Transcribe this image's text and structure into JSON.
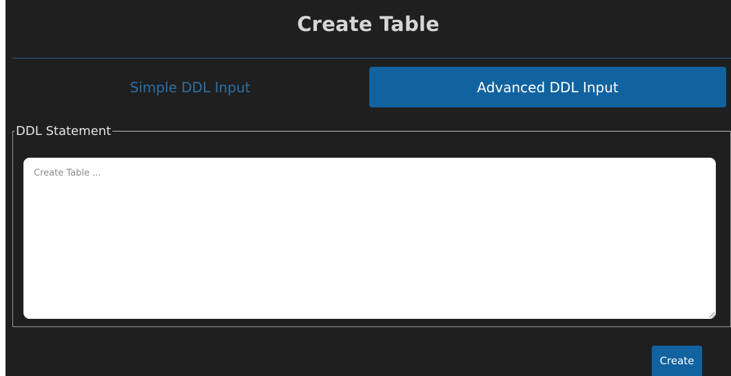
{
  "header": {
    "title": "Create Table"
  },
  "tabs": {
    "simple_label": "Simple DDL Input",
    "advanced_label": "Advanced DDL Input",
    "active": "advanced"
  },
  "ddl": {
    "legend": "DDL Statement",
    "placeholder": "Create Table ...",
    "value": ""
  },
  "actions": {
    "create_label": "Create"
  },
  "colors": {
    "background": "#1f1f1f",
    "accent": "#1163a0",
    "inactive_tab_text": "#2f6fa3",
    "divider": "#2c5a82"
  }
}
